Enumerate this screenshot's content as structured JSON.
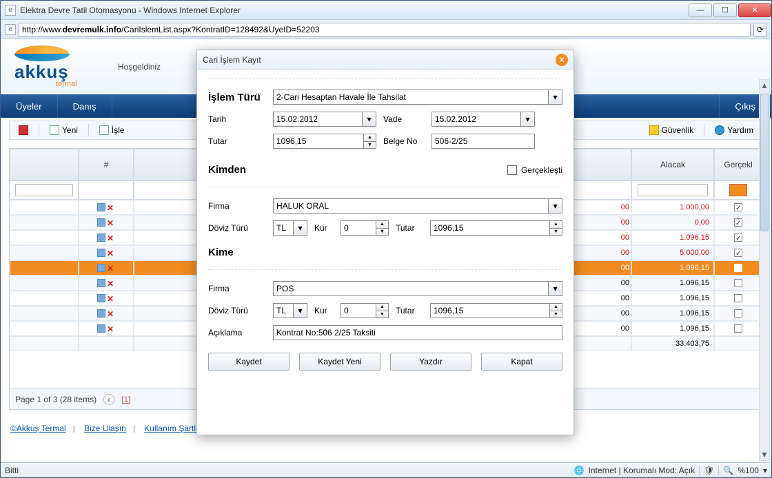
{
  "window": {
    "title": "Elektra Devre Tatil Otomasyonu - Windows Internet Explorer",
    "url_pre": "http://www.",
    "url_bold": "devremulk.info",
    "url_rest": "/CariIslemList.aspx?KontratID=128492&UyeID=52203"
  },
  "winbtn": {
    "min": "—",
    "max": "☐",
    "close": "✕"
  },
  "logo": {
    "name": "akkuş",
    "sub": "termal"
  },
  "welcome": "Hoşgeldiniz",
  "nav": {
    "uyeler": "Üyeler",
    "danis": "Danış",
    "spacer": "",
    "cikis": "Çıkış"
  },
  "toolbar": {
    "yeni": "Yeni",
    "isle": "İşle",
    "guvenlik": "Güvenlik",
    "yardim": "Yardım"
  },
  "grid": {
    "head": {
      "num": "#",
      "alacak": "Alacak",
      "gercek": "Gerçekl"
    },
    "rows": [
      {
        "alacak": "1.000,00",
        "red": true,
        "chk": true
      },
      {
        "alacak": "0,00",
        "red": true,
        "chk": true
      },
      {
        "alacak": "1.096,15",
        "red": true,
        "chk": true
      },
      {
        "alacak": "5.000,00",
        "red": true,
        "chk": true
      },
      {
        "alacak": "1.096,15",
        "red": false,
        "chk": false,
        "sel": true
      },
      {
        "alacak": "1.096,15",
        "red": false,
        "chk": false
      },
      {
        "alacak": "1.096,15",
        "red": false,
        "chk": false
      },
      {
        "alacak": "1.096,15",
        "red": false,
        "chk": false
      },
      {
        "alacak": "1.096,15",
        "red": false,
        "chk": false
      },
      {
        "alacak": "33.403,75",
        "red": false,
        "total": true
      }
    ],
    "truncatedLeft": "00",
    "pager": {
      "text": "Page 1 of 3 (28 items)",
      "curr": "[1]"
    }
  },
  "footer": {
    "akkus": "©Akkuş Termal",
    "bize": "Bize Ulaşın",
    "kullanim": "Kullanım Şartları"
  },
  "status": {
    "left": "Bitti",
    "internet": "Internet | Korumalı Mod: Açık",
    "zoom": "%100"
  },
  "modal": {
    "title": "Cari İşlem Kayıt",
    "islem_label": "İşlem Türü",
    "islem_value": "2-Cari Hesaptan Havale İle Tahsilat",
    "tarih_label": "Tarih",
    "tarih_value": "15.02.2012",
    "vade_label": "Vade",
    "vade_value": "15.02.2012",
    "tutar_label": "Tutar",
    "tutar_value": "1096,15",
    "belge_label": "Belge No",
    "belge_value": "506-2/25",
    "kimden": "Kimden",
    "gerceklesti": "Gerçekleşti",
    "firma_label": "Firma",
    "firma1": "HALUK ORAL",
    "doviz_label": "Döviz Türü",
    "doviz_value": "TL",
    "kur_label": "Kur",
    "kur_value": "0",
    "tutar2_label": "Tutar",
    "tutar2_value": "1096,15",
    "kime": "Kime",
    "firma2": "POS",
    "doviz2_value": "TL",
    "kur2_value": "0",
    "tutar3_value": "1096,15",
    "aciklama_label": "Açıklama",
    "aciklama_value": "Kontrat No:506 2/25 Taksiti",
    "btn": {
      "kaydet": "Kaydet",
      "kaydetyeni": "Kaydet Yeni",
      "yazdir": "Yazdır",
      "kapat": "Kapat"
    }
  }
}
